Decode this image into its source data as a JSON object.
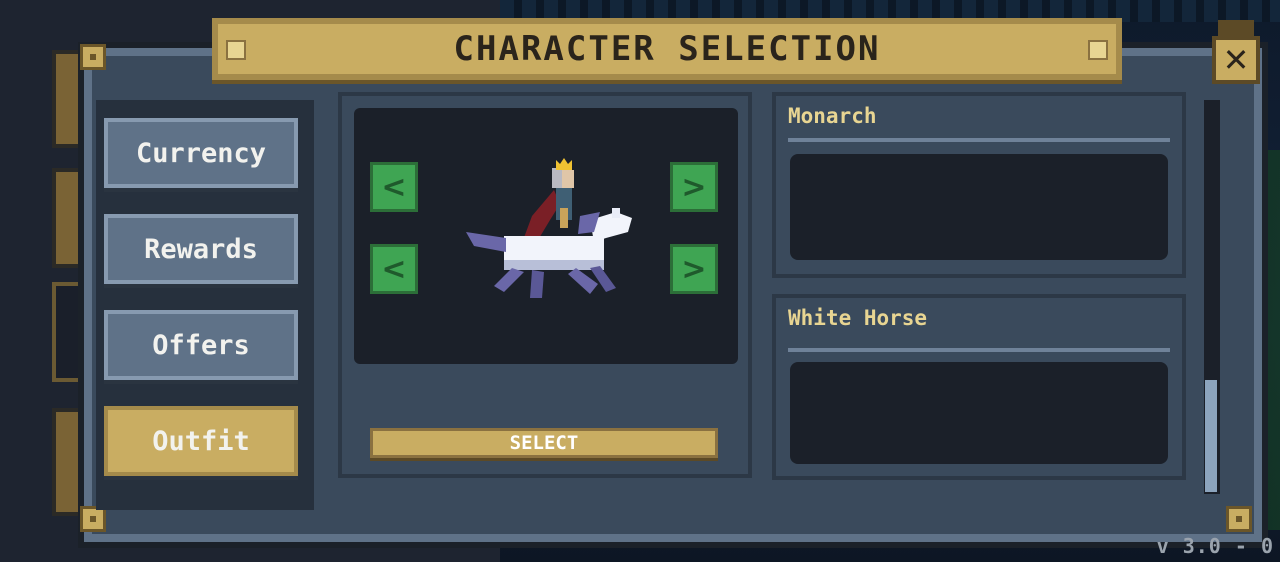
{
  "title": "CHARACTER SELECTION",
  "close_icon": "close-x-icon",
  "nav": {
    "items": [
      {
        "label": "Currency",
        "active": false
      },
      {
        "label": "Rewards",
        "active": false
      },
      {
        "label": "Offers",
        "active": false
      },
      {
        "label": "Outfit",
        "active": true
      }
    ]
  },
  "preview": {
    "character": "monarch-on-white-horse",
    "left_arrow_icon": "chevron-left-icon",
    "right_arrow_icon": "chevron-right-icon",
    "select_label": "SELECT"
  },
  "cards": [
    {
      "title": "Monarch"
    },
    {
      "title": "White Horse"
    }
  ],
  "version": "v 3.0 - 0",
  "colors": {
    "gold": "#c9ad62",
    "panel": "#3a4a5c",
    "green": "#3fa553",
    "title_text": "#e8d592"
  }
}
